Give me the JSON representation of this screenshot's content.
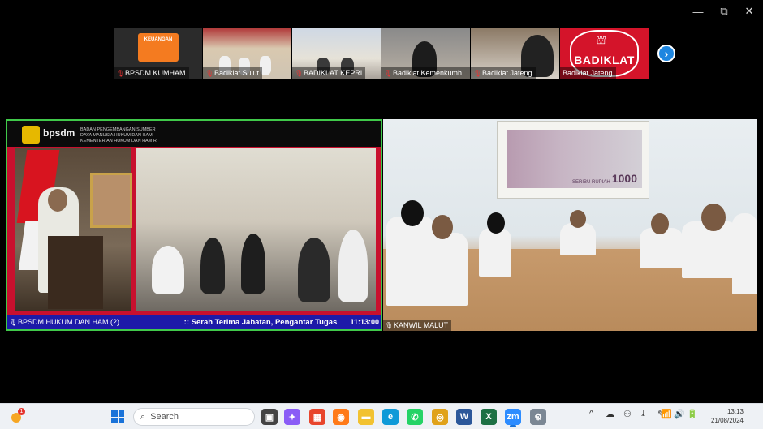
{
  "window": {
    "controls": {
      "minimize": "—",
      "maximize": "⧉",
      "close": "✕"
    }
  },
  "participants": [
    {
      "name": "BPSDM KUMHAM",
      "muted": true,
      "tile_text": "KEUANGAN"
    },
    {
      "name": "Badiklat Sulut",
      "muted": true
    },
    {
      "name": "BADIKLAT KEPRI",
      "muted": true
    },
    {
      "name": "Badiklat Kemenkumh...",
      "muted": true
    },
    {
      "name": "Badiklat Jateng",
      "muted": true
    },
    {
      "name": "Badiklat Jateng",
      "muted": false,
      "tile_text": "BADIKLAT"
    }
  ],
  "main_left": {
    "header_brand": "bpsdm",
    "header_org": "BADAN PENGEMBANGAN SUMBER DAYA MANUSIA HUKUM DAN HAM KEMENTERIAN HUKUM DAN HAM RI",
    "participant_name": "BPSDM HUKUM DAN HAM (2)",
    "ticker": ":: Serah Terima Jabatan, Pengantar Tugas",
    "clock": "11:13:00"
  },
  "main_right": {
    "participant_name": "KANWIL MALUT",
    "banknote_value": "1000",
    "banknote_text": "SERIBU RUPIAH"
  },
  "taskbar": {
    "weather_badge": "1",
    "search_placeholder": "Search",
    "apps": [
      {
        "name": "task-view",
        "color": "#444444",
        "glyph": "▣"
      },
      {
        "name": "copilot",
        "color": "#8a5cf6",
        "glyph": "✦"
      },
      {
        "name": "store",
        "color": "#e8452c",
        "glyph": "▦"
      },
      {
        "name": "firefox",
        "color": "#ff7a18",
        "glyph": "◉"
      },
      {
        "name": "file-explorer",
        "color": "#f2c230",
        "glyph": "▬"
      },
      {
        "name": "edge",
        "color": "#0f9ad8",
        "glyph": "e"
      },
      {
        "name": "whatsapp",
        "color": "#25d366",
        "glyph": "✆"
      },
      {
        "name": "chrome",
        "color": "#e0a21a",
        "glyph": "◎"
      },
      {
        "name": "word",
        "color": "#2b579a",
        "glyph": "W"
      },
      {
        "name": "excel",
        "color": "#1d7044",
        "glyph": "X"
      },
      {
        "name": "zoom",
        "color": "#2d8cff",
        "glyph": "zm"
      },
      {
        "name": "settings",
        "color": "#7b8794",
        "glyph": "⚙"
      }
    ],
    "tray": [
      "^",
      "☁",
      "⚇",
      "⤓",
      "✎",
      "🎙",
      "📶",
      "🔊",
      "🔋"
    ],
    "time": "13:13",
    "date": "21/08/2024"
  }
}
